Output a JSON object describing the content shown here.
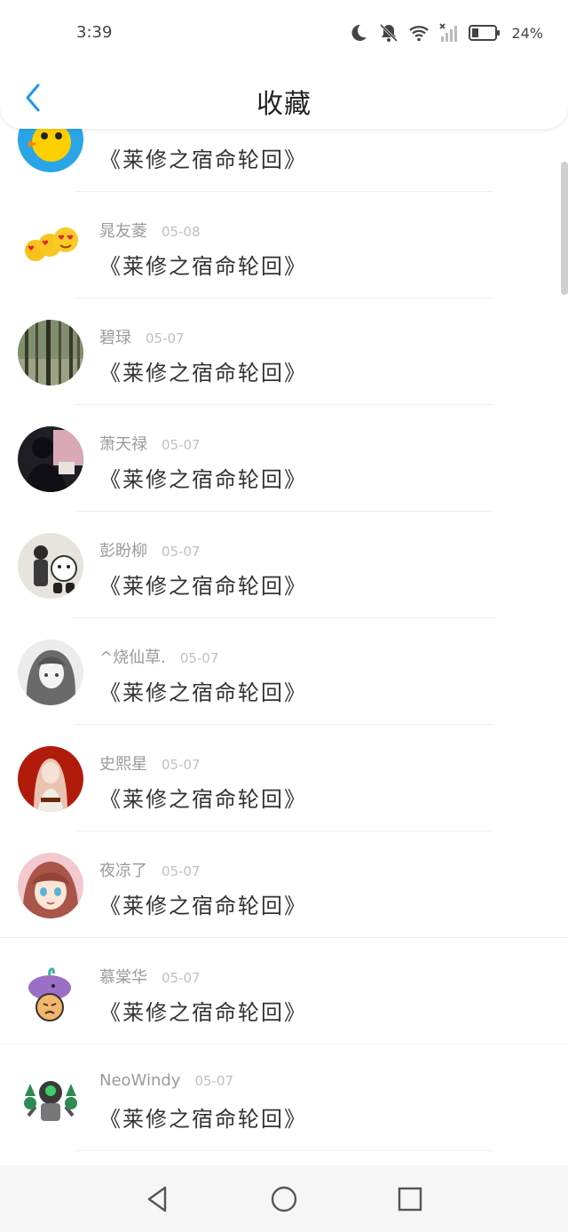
{
  "status_bar": {
    "time": "3:39",
    "battery_percent": "24%",
    "icons": [
      "moon-icon",
      "bell-off-icon",
      "wifi-icon",
      "signal-icon",
      "battery-icon"
    ]
  },
  "header": {
    "title": "收藏",
    "accent_color": "#2196f3"
  },
  "items": [
    {
      "name": "",
      "date": "",
      "comment": "《莱修之宿命轮回》",
      "avatar": "yellow-chick"
    },
    {
      "name": "晁友菱",
      "date": "05-08",
      "comment": "《莱修之宿命轮回》",
      "avatar": "heart-eyes-emoji"
    },
    {
      "name": "碧琭",
      "date": "05-07",
      "comment": "《莱修之宿命轮回》",
      "avatar": "forest"
    },
    {
      "name": "萧天禄",
      "date": "05-07",
      "comment": "《莱修之宿命轮回》",
      "avatar": "dark-portrait"
    },
    {
      "name": "彭盼柳",
      "date": "05-07",
      "comment": "《莱修之宿命轮回》",
      "avatar": "sketch-girl"
    },
    {
      "name": "^烧仙草.",
      "date": "05-07",
      "comment": "《莱修之宿命轮回》",
      "avatar": "gray-anime"
    },
    {
      "name": "史熙星",
      "date": "05-07",
      "comment": "《莱修之宿命轮回》",
      "avatar": "red-anime"
    },
    {
      "name": "夜凉了",
      "date": "05-07",
      "comment": "《莱修之宿命轮回》",
      "avatar": "bangs-girl"
    },
    {
      "name": "慕棠华",
      "date": "05-07",
      "comment": "《莱修之宿命轮回》",
      "avatar": "whale-cartoon"
    },
    {
      "name": "NeoWindy",
      "date": "05-07",
      "comment": "《莱修之宿命轮回》",
      "avatar": "robot-cartoon"
    }
  ],
  "nav": {
    "buttons": [
      "back-triangle",
      "home-circle",
      "recents-square"
    ]
  }
}
